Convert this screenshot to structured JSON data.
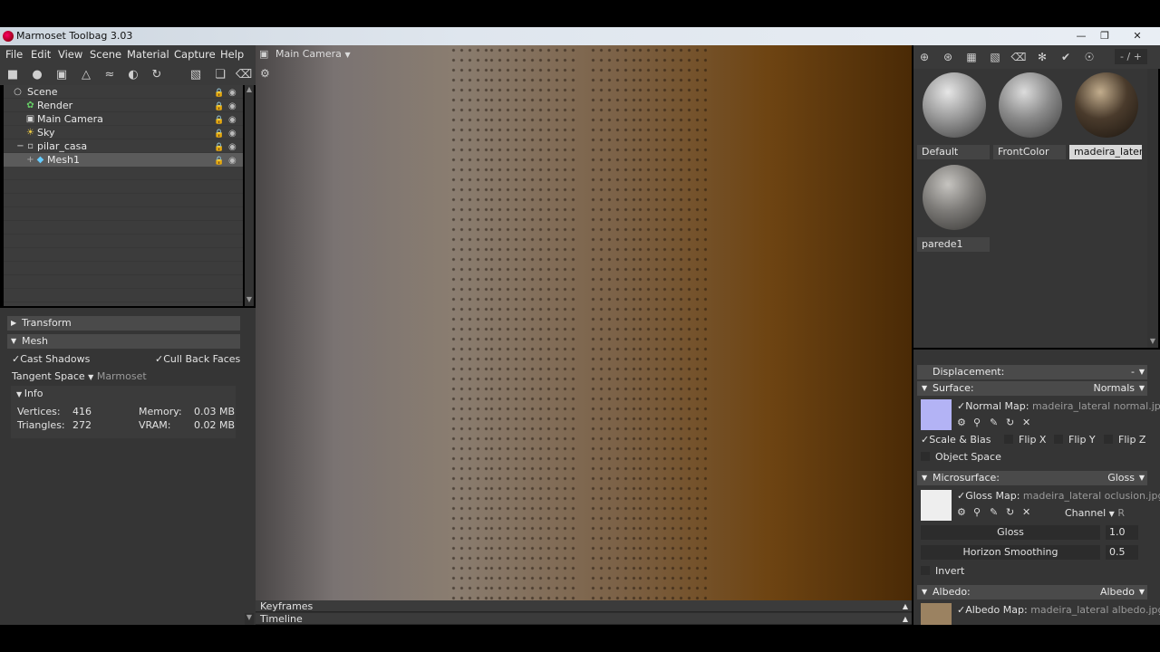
{
  "window": {
    "title": "Marmoset Toolbag 3.03",
    "minimize": "—",
    "maximize": "❐",
    "close": "✕"
  },
  "menu": [
    "File",
    "Edit",
    "View",
    "Scene",
    "Material",
    "Capture",
    "Help"
  ],
  "scene_tree": [
    {
      "label": "Scene",
      "icon": "scene-icon"
    },
    {
      "label": "Render",
      "icon": "render-icon"
    },
    {
      "label": "Main Camera",
      "icon": "camera-icon"
    },
    {
      "label": "Sky",
      "icon": "sky-icon"
    },
    {
      "label": "pilar_casa",
      "icon": "file-icon"
    },
    {
      "label": "Mesh1",
      "icon": "mesh-icon",
      "selected": true
    }
  ],
  "left_props": {
    "transform_label": "Transform",
    "mesh_label": "Mesh",
    "cast_shadows": "Cast Shadows",
    "cull_back_faces": "Cull Back Faces",
    "tangent_space_label": "Tangent Space",
    "tangent_space_value": "Marmoset",
    "info_label": "Info",
    "vertices_label": "Vertices:",
    "vertices_value": "416",
    "triangles_label": "Triangles:",
    "triangles_value": "272",
    "memory_label": "Memory:",
    "memory_value": "0.03 MB",
    "vram_label": "VRAM:",
    "vram_value": "0.02 MB"
  },
  "viewport": {
    "camera_label": "Main Camera"
  },
  "bottom": {
    "keyframes": "Keyframes",
    "timeline": "Timeline"
  },
  "right_toolbar": {
    "page": "- / +"
  },
  "materials": [
    {
      "name": "Default",
      "color": "#9a9a9a"
    },
    {
      "name": "FrontColor",
      "color": "#8a8a8a"
    },
    {
      "name": "madeira_lateral",
      "color": "#4a3b2c",
      "selected": true
    },
    {
      "name": "parede1",
      "color": "#7d7b78"
    }
  ],
  "mat_props": {
    "displacement_label": "Displacement:",
    "displacement_value": "-",
    "surface_label": "Surface:",
    "surface_value": "Normals",
    "normal_map_label": "Normal Map:",
    "normal_map_file": "madeira_lateral normal.jpg",
    "scale_bias": "Scale & Bias",
    "flip_x": "Flip X",
    "flip_y": "Flip Y",
    "flip_z": "Flip Z",
    "object_space": "Object Space",
    "microsurface_label": "Microsurface:",
    "microsurface_value": "Gloss",
    "gloss_map_label": "Gloss Map:",
    "gloss_map_file": "madeira_lateral oclusion.jpg",
    "channel_label": "Channel",
    "channel_value": "R",
    "gloss_label": "Gloss",
    "gloss_value": "1.0",
    "horizon_label": "Horizon Smoothing",
    "horizon_value": "0.5",
    "invert": "Invert",
    "albedo_label": "Albedo:",
    "albedo_value": "Albedo",
    "albedo_map_label": "Albedo Map:",
    "albedo_map_file": "madeira_lateral albedo.jpg",
    "normal_swatch_color": "#b3b3f5",
    "gloss_swatch_color": "#eeeeee"
  }
}
